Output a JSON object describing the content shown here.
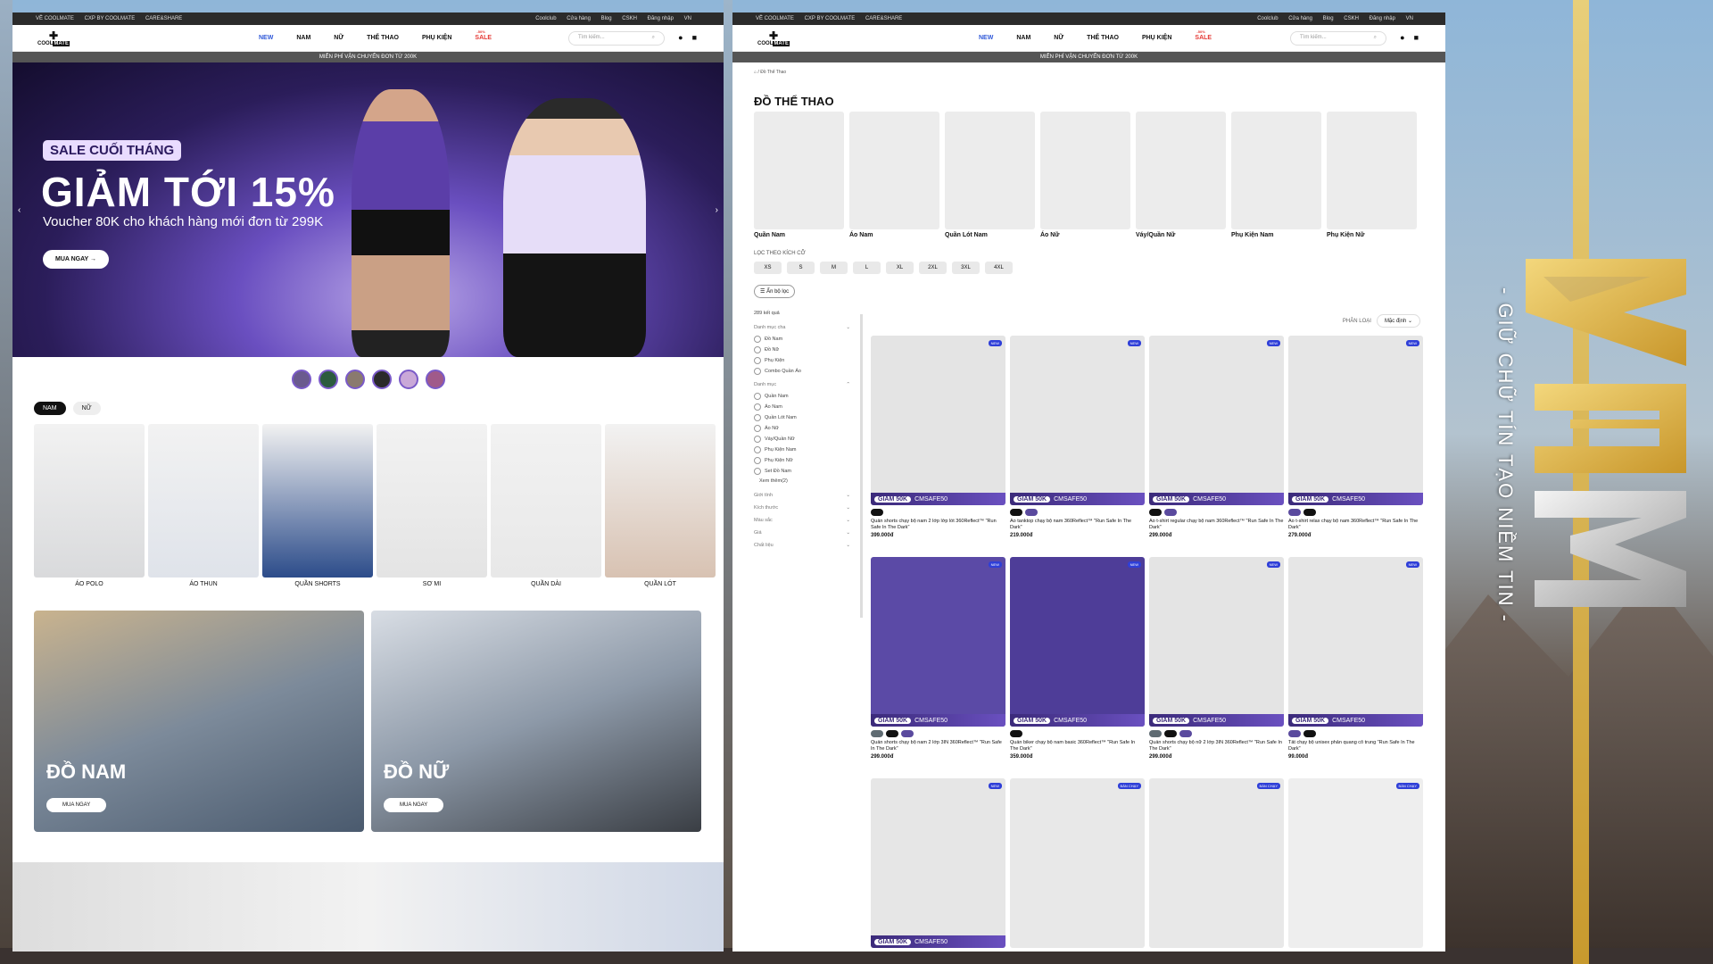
{
  "overlay": {
    "slogan": "- GIỮ CHỮ TÍN TẠO NIỀM TIN -",
    "logo_text": "A3M"
  },
  "site": {
    "topbar_left": [
      "VỀ COOLMATE",
      "CXP BY COOLMATE",
      "CARE&SHARE"
    ],
    "topbar_right": [
      "Coolclub",
      "Cửa hàng",
      "Blog",
      "CSKH",
      "Đăng nhập",
      "VN"
    ],
    "logo_top": "COOL",
    "logo_bottom": "MATE",
    "menu": [
      "NEW",
      "NAM",
      "NỮ",
      "THỂ THAO",
      "PHỤ KIỆN",
      "SALE"
    ],
    "sale_badge": "-50%",
    "search_placeholder": "Tìm kiếm...",
    "promo": "MIỄN PHÍ VẬN CHUYỂN ĐƠN TỪ 200K"
  },
  "home": {
    "hero_badge": "SALE CUỐI THÁNG",
    "hero_headline": "GIẢM TỚI 15%",
    "hero_sub": "Voucher 80K cho khách hàng mới đơn từ 299K",
    "hero_cta": "MUA NGAY",
    "tabs": [
      "NAM",
      "NỮ"
    ],
    "categories": [
      {
        "label": "ÁO POLO",
        "color": "#d9dadc"
      },
      {
        "label": "ÁO THUN",
        "color": "#dfe3ea"
      },
      {
        "label": "QUẦN SHORTS",
        "color": "#2c4c8a"
      },
      {
        "label": "SƠ MI",
        "color": "#e4e4e4"
      },
      {
        "label": "QUẦN DÀI",
        "color": "#e8e8e8"
      },
      {
        "label": "QUẦN LÓT",
        "color": "#d8c2b2"
      }
    ],
    "banners": [
      {
        "title": "ĐỒ NAM",
        "cta": "MUA NGAY"
      },
      {
        "title": "ĐỒ NỮ",
        "cta": "MUA NGAY"
      }
    ]
  },
  "sport": {
    "breadcrumb": "⌂ / Đồ Thể Thao",
    "title": "ĐỒ THỂ THAO",
    "categories": [
      "Quần Nam",
      "Áo Nam",
      "Quần Lót Nam",
      "Áo Nữ",
      "Váy/Quần Nữ",
      "Phụ Kiện Nam",
      "Phụ Kiện Nữ"
    ],
    "size_title": "LỌC THEO KÍCH CỠ",
    "sizes": [
      "XS",
      "S",
      "M",
      "L",
      "XL",
      "2XL",
      "3XL",
      "4XL"
    ],
    "filter_toggle": "Ẩn bộ lọc",
    "result_count": "289 kết quả",
    "sort_label": "PHÂN LOẠI",
    "sort_value": "Mặc định",
    "filter_groups": [
      {
        "title": "Danh mục cha",
        "options": [
          "Đồ Nam",
          "Đồ Nữ",
          "Phụ Kiện",
          "Combo Quần Áo"
        ]
      },
      {
        "title": "Danh mục",
        "options": [
          "Quần Nam",
          "Áo Nam",
          "Quần Lót Nam",
          "Áo Nữ",
          "Váy/Quần Nữ",
          "Phụ Kiện Nam",
          "Phụ Kiện Nữ",
          "Set Đồ Nam"
        ]
      }
    ],
    "see_more": "Xem thêm(2)",
    "collapsed_groups": [
      "Giới tính",
      "Kích thước",
      "Màu sắc",
      "Giá",
      "Chất liệu"
    ],
    "promo_badge": "GIẢM 50K",
    "promo_code": "CMSAFE50",
    "products": [
      {
        "tag": "NEW",
        "name": "Quần shorts chạy bộ nam 2 lớp lớp lót 360Reflect™ \"Run Safe In The Dark\"",
        "price": "399.000đ",
        "swatches": [
          "#111111"
        ],
        "color": "#e4e4e4",
        "promo": true
      },
      {
        "tag": "NEW",
        "name": "Áo tanktop chạy bộ nam 360Reflect™ \"Run Safe In The Dark\"",
        "price": "219.000đ",
        "swatches": [
          "#111111",
          "#5a4a9e"
        ],
        "color": "#e6e6e6",
        "promo": true
      },
      {
        "tag": "NEW",
        "name": "Áo t-shirt regular chạy bộ nam 360Reflect™ \"Run Safe In The Dark\"",
        "price": "299.000đ",
        "swatches": [
          "#111111",
          "#5a4a9e"
        ],
        "color": "#e6e6e6",
        "promo": true
      },
      {
        "tag": "NEW",
        "name": "Áo t-shirt relax chạy bộ nam 360Reflect™ \"Run Safe In The Dark\"",
        "price": "279.000đ",
        "swatches": [
          "#5a4a9e",
          "#111111"
        ],
        "color": "#e6e6e6",
        "promo": true
      },
      {
        "tag": "NEW",
        "name": "Quần shorts chạy bộ nam 2 lớp 3IN 360Reflect™ \"Run Safe In The Dark\"",
        "price": "299.000đ",
        "swatches": [
          "#5f6b72",
          "#111111",
          "#5a4a9e"
        ],
        "color": "#5b4aa6",
        "promo": true
      },
      {
        "tag": "NEW",
        "name": "Quần biker chạy bộ nam basic 360Reflect™ \"Run Safe In The Dark\"",
        "price": "359.000đ",
        "swatches": [
          "#111111"
        ],
        "color": "#4e3d98",
        "promo": true
      },
      {
        "tag": "NEW",
        "name": "Quần shorts chạy bộ nữ 2 lớp 3IN 360Reflect™ \"Run Safe In The Dark\"",
        "price": "299.000đ",
        "swatches": [
          "#5f6b72",
          "#111111",
          "#5a4a9e"
        ],
        "color": "#e4e4e4",
        "promo": true
      },
      {
        "tag": "NEW",
        "name": "Tất chạy bộ unisex phản quang cổ trung \"Run Safe In The Dark\"",
        "price": "99.000đ",
        "swatches": [
          "#5a4a9e",
          "#111111"
        ],
        "color": "#e6e6e6",
        "promo": true
      },
      {
        "tag": "NEW",
        "name": "",
        "price": "",
        "swatches": [],
        "color": "#e6e6e6",
        "promo": true
      },
      {
        "tag": "BÁN CHẠY",
        "name": "",
        "price": "",
        "swatches": [],
        "color": "#e8e8e8",
        "promo": false
      },
      {
        "tag": "BÁN CHẠY",
        "name": "",
        "price": "",
        "swatches": [],
        "color": "#e8e8e8",
        "promo": false
      },
      {
        "tag": "BÁN CHẠY",
        "name": "",
        "price": "",
        "swatches": [],
        "color": "#eeeeee",
        "promo": false
      }
    ]
  }
}
